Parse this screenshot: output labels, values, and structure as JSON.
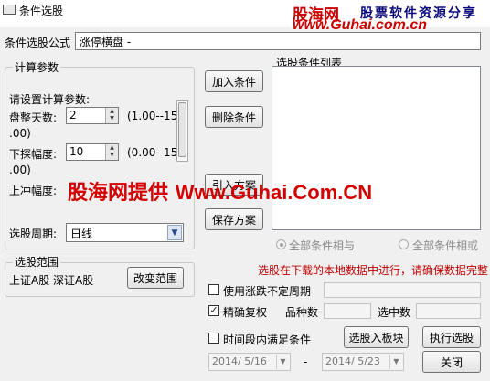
{
  "window": {
    "title": "条件选股"
  },
  "watermark": {
    "brand": "股海网",
    "slogan": "股票软件资源分享",
    "url": "www.Guhai.com.cn",
    "overlay_prefix": "股海网提供",
    "overlay_url": "Www.Guhai.Com.CN",
    "color": "#d40000"
  },
  "formula": {
    "label": "条件选股公式",
    "value": "涨停横盘 -"
  },
  "calc": {
    "group_title": "计算参数",
    "prompt": "请设置计算参数:",
    "params": [
      {
        "label": "盘整天数:",
        "value": "2",
        "range": "(1.00--15",
        "range_cont": ".00)"
      },
      {
        "label": "下探幅度:",
        "value": "10",
        "range": "(0.00--15",
        "range_cont": ".00)"
      },
      {
        "label": "上冲幅度:"
      }
    ]
  },
  "period": {
    "label": "选股周期:",
    "value": "日线"
  },
  "scope": {
    "group_title": "选股范围",
    "value": "上证A股  深证A股",
    "button": "改变范围"
  },
  "buttons": {
    "add": "加入条件",
    "delete": "删除条件",
    "import": "引入方案",
    "save": "保存方案",
    "to_block": "选股入板块",
    "execute": "执行选股",
    "close": "关闭"
  },
  "condition_list": {
    "label": "选股条件列表"
  },
  "logic": {
    "and": "全部条件相与",
    "or": "全部条件相或"
  },
  "notice": {
    "text": "选股在下载的本地数据中进行，请确保数据完整",
    "color": "#c00000"
  },
  "options": {
    "variable_period": "使用涨跌不定周期",
    "exact_rights": "精确复权",
    "time_range": "时间段内满足条件"
  },
  "counts": {
    "stock_count_label": "品种数",
    "selected_label": "选中数"
  },
  "dates": {
    "start": "2014/ 5/16",
    "separator": "-",
    "end": "2014/ 5/23"
  }
}
